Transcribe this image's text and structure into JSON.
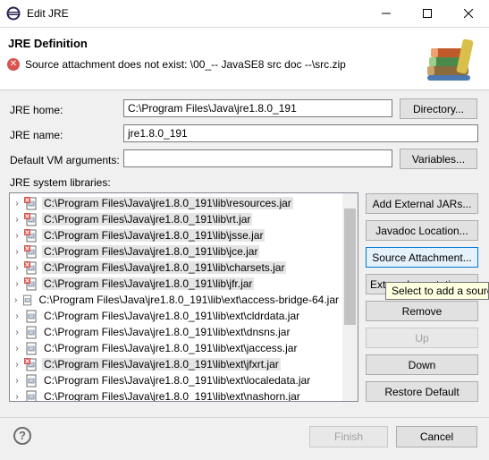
{
  "window": {
    "title": "Edit JRE"
  },
  "header": {
    "title": "JRE Definition",
    "message": "Source attachment does not exist: \\00_-- JavaSE8 src doc --\\src.zip"
  },
  "form": {
    "jre_home_label": "JRE home:",
    "jre_home_value": "C:\\Program Files\\Java\\jre1.8.0_191",
    "directory_button": "Directory...",
    "jre_name_label": "JRE name:",
    "jre_name_value": "jre1.8.0_191",
    "vm_args_label": "Default VM arguments:",
    "vm_args_value": "",
    "variables_button": "Variables...",
    "libraries_label": "JRE system libraries:"
  },
  "libraries": [
    {
      "path": "C:\\Program Files\\Java\\jre1.8.0_191\\lib\\resources.jar",
      "error": true
    },
    {
      "path": "C:\\Program Files\\Java\\jre1.8.0_191\\lib\\rt.jar",
      "error": true
    },
    {
      "path": "C:\\Program Files\\Java\\jre1.8.0_191\\lib\\jsse.jar",
      "error": true
    },
    {
      "path": "C:\\Program Files\\Java\\jre1.8.0_191\\lib\\jce.jar",
      "error": true
    },
    {
      "path": "C:\\Program Files\\Java\\jre1.8.0_191\\lib\\charsets.jar",
      "error": true
    },
    {
      "path": "C:\\Program Files\\Java\\jre1.8.0_191\\lib\\jfr.jar",
      "error": true
    },
    {
      "path": "C:\\Program Files\\Java\\jre1.8.0_191\\lib\\ext\\access-bridge-64.jar",
      "error": false
    },
    {
      "path": "C:\\Program Files\\Java\\jre1.8.0_191\\lib\\ext\\cldrdata.jar",
      "error": false
    },
    {
      "path": "C:\\Program Files\\Java\\jre1.8.0_191\\lib\\ext\\dnsns.jar",
      "error": false
    },
    {
      "path": "C:\\Program Files\\Java\\jre1.8.0_191\\lib\\ext\\jaccess.jar",
      "error": false
    },
    {
      "path": "C:\\Program Files\\Java\\jre1.8.0_191\\lib\\ext\\jfxrt.jar",
      "error": true
    },
    {
      "path": "C:\\Program Files\\Java\\jre1.8.0_191\\lib\\ext\\localedata.jar",
      "error": false
    },
    {
      "path": "C:\\Program Files\\Java\\jre1.8.0_191\\lib\\ext\\nashorn.jar",
      "error": false
    }
  ],
  "side_buttons": {
    "add_external_jars": "Add External JARs...",
    "javadoc_location": "Javadoc Location...",
    "source_attachment": "Source Attachment...",
    "external_annotations": "External annotations...",
    "remove": "Remove",
    "up": "Up",
    "down": "Down",
    "restore_default": "Restore Default"
  },
  "tooltip": "Select to add a source",
  "footer": {
    "finish": "Finish",
    "cancel": "Cancel"
  },
  "icons": {
    "app": "eclipse-icon",
    "error": "error-icon",
    "header_image": "books-icon",
    "jar": "jar-icon",
    "help": "help-icon"
  },
  "colors": {
    "error": "#d9534f",
    "focus": "#0078d7",
    "selection_gray": "#e5e5e5"
  }
}
